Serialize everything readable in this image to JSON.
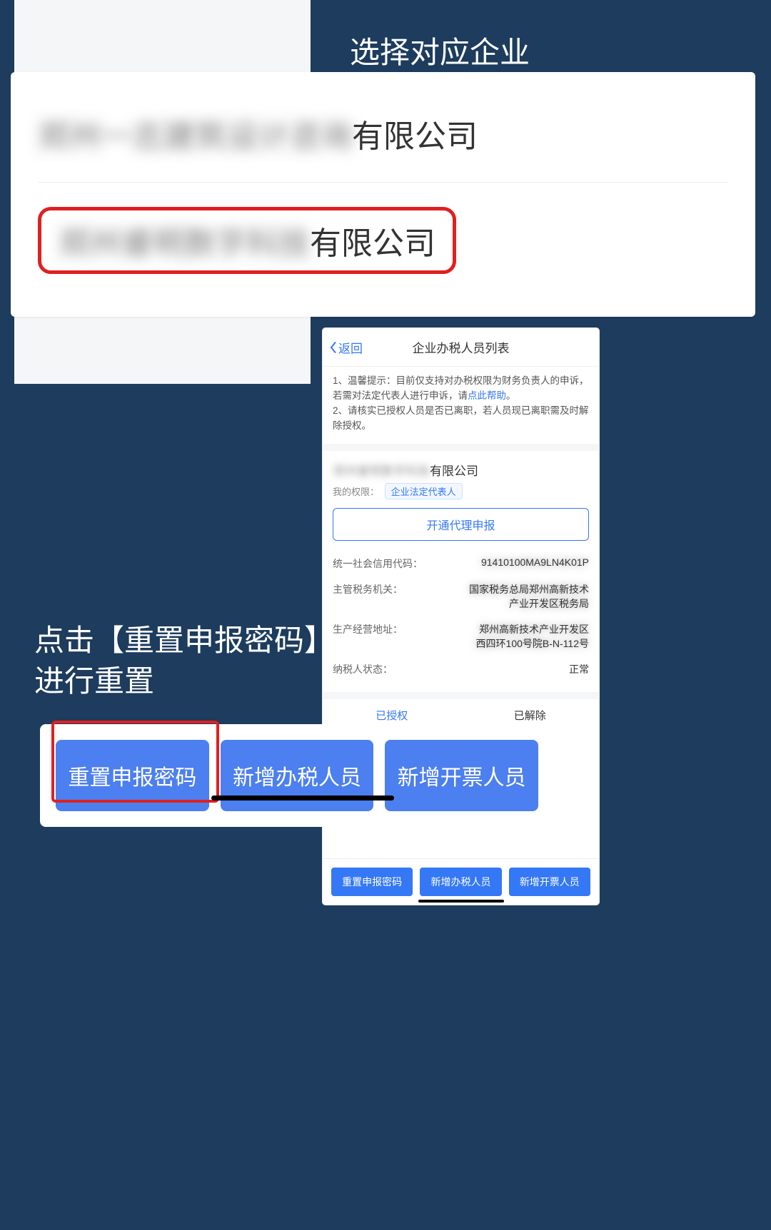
{
  "annotations": {
    "top": "选择对应企业",
    "mid_line1": "点击【重置申报密码】",
    "mid_line2": "进行重置"
  },
  "company_list": {
    "item1_suffix": "有限公司",
    "item2_suffix": "有限公司"
  },
  "phone": {
    "back_label": "返回",
    "title": "企业办税人员列表",
    "notice_line1_prefix": "1、温馨提示：目前仅支持对办税权限为财务负责人的申诉，若需对法定代表人进行申诉，请",
    "notice_link": "点此帮助",
    "notice_line1_suffix": "。",
    "notice_line2": "2、请核实已授权人员是否已离职，若人员现已离职需及时解除授权。",
    "company_suffix": "有限公司",
    "perm_label": "我的权限：",
    "perm_tag": "企业法定代表人",
    "open_proxy": "开通代理申报",
    "credit_code_label": "统一社会信用代码：",
    "tax_authority_label": "主管税务机关：",
    "address_label": "生产经营地址：",
    "status_label": "纳税人状态：",
    "status_value": "正常",
    "tab_authorized": "已授权",
    "tab_removed": "已解除",
    "btn_reset": "重置申报密码",
    "btn_add_tax": "新增办税人员",
    "btn_add_invoice": "新增开票人员"
  },
  "big_buttons": {
    "reset": "重置申报密码",
    "add_tax": "新增办税人员",
    "add_invoice": "新增开票人员"
  }
}
